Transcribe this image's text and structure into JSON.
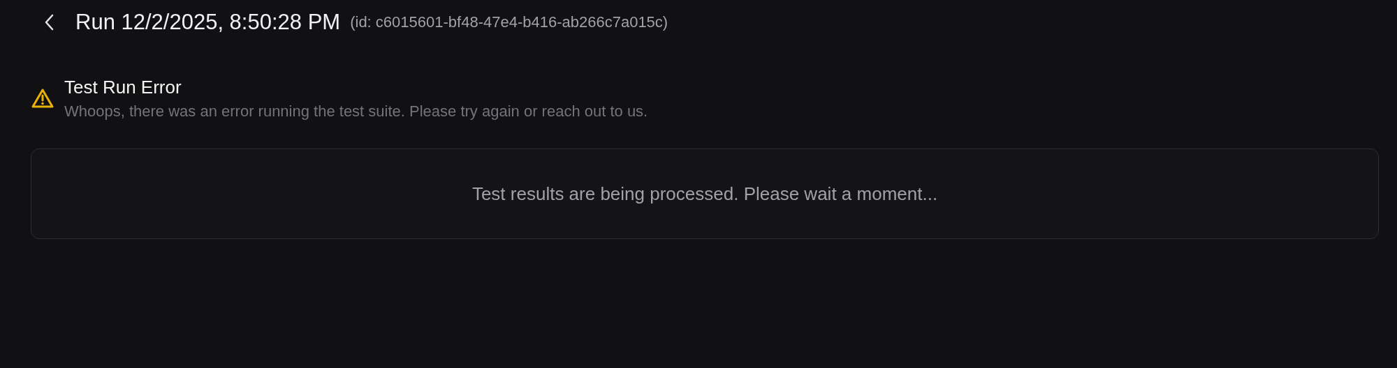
{
  "header": {
    "title": "Run 12/2/2025, 8:50:28 PM",
    "id_label": "(id: c6015601-bf48-47e4-b416-ab266c7a015c)"
  },
  "alert": {
    "title": "Test Run Error",
    "message": "Whoops, there was an error running the test suite. Please try again or reach out to us."
  },
  "results": {
    "message": "Test results are being processed. Please wait a moment..."
  }
}
